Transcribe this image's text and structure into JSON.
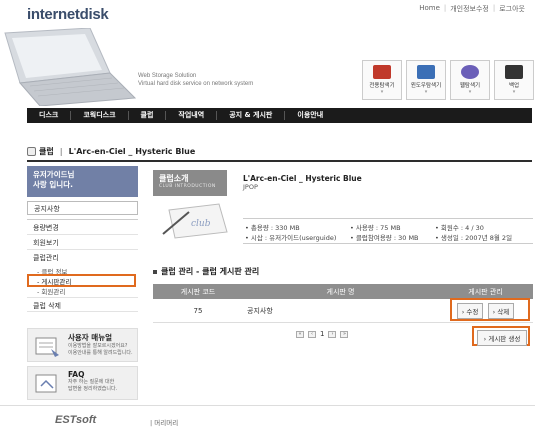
{
  "header": {
    "logo": "internetdisk",
    "links": [
      "Home",
      "개인정보수정",
      "로그아웃"
    ],
    "tagline1": "Web Storage Solution",
    "tagline2": "Virtual hard disk service on network system",
    "tools": [
      {
        "label": "전용탐색기",
        "icon": "explorer-icon",
        "color": "#c0392b"
      },
      {
        "label": "윈도우탐색기",
        "icon": "windows-explorer-icon",
        "color": "#3b6fb6"
      },
      {
        "label": "웹탐색기",
        "icon": "web-explorer-icon",
        "color": "#6b5fb8"
      },
      {
        "label": "백업",
        "icon": "backup-icon",
        "color": "#333333"
      }
    ]
  },
  "nav": [
    "디스크",
    "코웍디스크",
    "클럽",
    "작업내역",
    "공지 & 게시판",
    "이용안내"
  ],
  "breadcrumb": {
    "section": "클럽",
    "club": "L'Arc-en-Ciel _ Hysteric Blue"
  },
  "sidebar": {
    "greeting_line1": "유저가이드님",
    "greeting_line2": "사랑 입니다.",
    "notice": "공지사항",
    "menu": [
      "용량변경",
      "회원보기",
      "클럽관리"
    ],
    "submenu": [
      "클럽 정보",
      "게시판관리",
      "회원관리"
    ],
    "delete": "클럽 삭제",
    "manual_title": "사용자 매뉴얼",
    "manual_desc1": "이용방법을 잘모르시겠어요?",
    "manual_desc2": "이용안내를 통해 알려드립니다.",
    "faq_title": "FAQ",
    "faq_desc1": "자주 하는 질문에 대한",
    "faq_desc2": "답변을 정리하였습니다."
  },
  "club": {
    "head_title": "클럽소개",
    "head_sub": "CLUB INTRODUCTION",
    "name": "L'Arc-en-Ciel _ Hysteric Blue",
    "category": "JPOP",
    "stat_total": "• 총용량 : 330 MB",
    "stat_used": "• 사용량 : 75 MB",
    "stat_members": "• 회원수 : 4 / 30",
    "stat_owner": "• 시삽 : 유저가이드(userguide)",
    "stat_join": "• 클럽참여용량 : 30 MB",
    "stat_created": "• 생성일 : 2007년 8월 2일"
  },
  "board": {
    "title": "클럽 관리 - 클럽 게시판 관리",
    "headers": [
      "게시판 코드",
      "게시판 명",
      "게시판 관리"
    ],
    "rows": [
      {
        "code": "75",
        "name": "공지사항",
        "edit": "› 수정",
        "delete": "› 삭제"
      }
    ],
    "page": "1",
    "create": "› 게시판 생성"
  },
  "footer": {
    "brand": "ESTsoft",
    "copy": "| 머리머리"
  }
}
